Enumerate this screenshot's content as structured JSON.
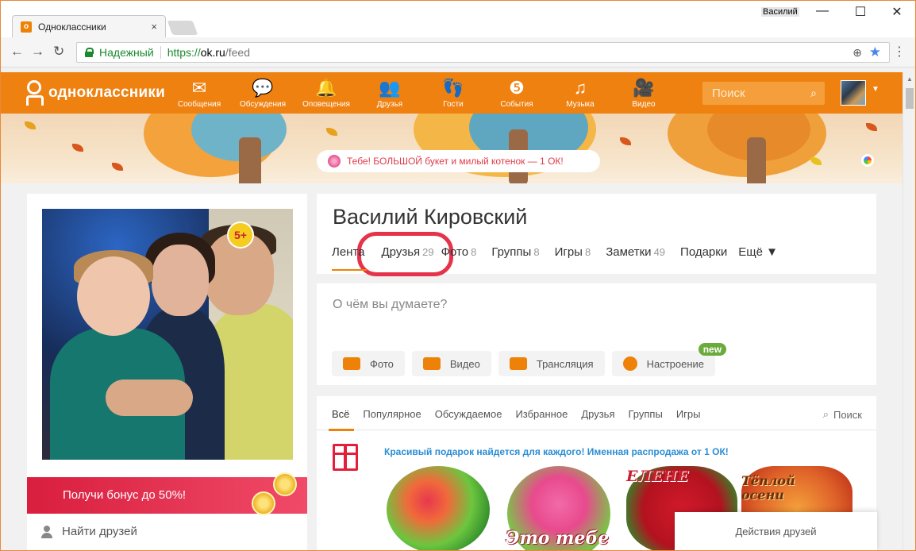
{
  "browser": {
    "tab_title": "Одноклассники",
    "tab_close": "×",
    "user": "Василий",
    "win_minimize": "—",
    "win_maximize": "☐",
    "win_close": "✕",
    "security_label": "Надежный",
    "url_scheme": "https://",
    "url_host": "ok.ru",
    "url_path": "/feed"
  },
  "site": {
    "logo_text": "одноклассники",
    "nav": [
      {
        "label": "Сообщения",
        "icon": "envelope-icon"
      },
      {
        "label": "Обсуждения",
        "icon": "discussions-icon"
      },
      {
        "label": "Оповещения",
        "icon": "bell-icon"
      },
      {
        "label": "Друзья",
        "icon": "friends-icon"
      },
      {
        "label": "Гости",
        "icon": "footprints-icon"
      },
      {
        "label": "События",
        "icon": "events-icon"
      },
      {
        "label": "Музыка",
        "icon": "music-icon"
      },
      {
        "label": "Видео",
        "icon": "video-icon"
      }
    ],
    "search_placeholder": "Поиск"
  },
  "banner": {
    "promo_text": "Тебе! БОЛЬШОЙ букет и милый котенок — 1 ОК!"
  },
  "profile": {
    "name": "Василий Кировский",
    "age_badge": "5+",
    "tabs": [
      {
        "label": "Лента",
        "count": ""
      },
      {
        "label": "Друзья",
        "count": "29"
      },
      {
        "label": "Фото",
        "count": "8"
      },
      {
        "label": "Группы",
        "count": "8"
      },
      {
        "label": "Игры",
        "count": "8"
      },
      {
        "label": "Заметки",
        "count": "49"
      },
      {
        "label": "Подарки",
        "count": ""
      },
      {
        "label": "Ещё ▼",
        "count": ""
      }
    ]
  },
  "left": {
    "bonus_text": "Получи бонус до 50%!",
    "find_friends": "Найти друзей"
  },
  "composer": {
    "placeholder": "О чём вы думаете?",
    "buttons": [
      "Фото",
      "Видео",
      "Трансляция",
      "Настроение"
    ],
    "new_badge": "new"
  },
  "feed": {
    "tabs": [
      "Всё",
      "Популярное",
      "Обсуждаемое",
      "Избранное",
      "Друзья",
      "Группы",
      "Игры"
    ],
    "search_label": "Поиск",
    "gift_promo": "Красивый подарок найдется для каждого! Именная распродажа от 1 ОК!",
    "gift_tiles": [
      "Это тебе",
      "ЕЛЕНЕ",
      "Тёплой осени"
    ]
  },
  "footer": {
    "friends_actions": "Действия друзей"
  },
  "colors": {
    "brand_orange": "#ef8110",
    "highlight_red": "#e5334a",
    "link_blue": "#2a8ed4",
    "new_green": "#6aab3b"
  }
}
